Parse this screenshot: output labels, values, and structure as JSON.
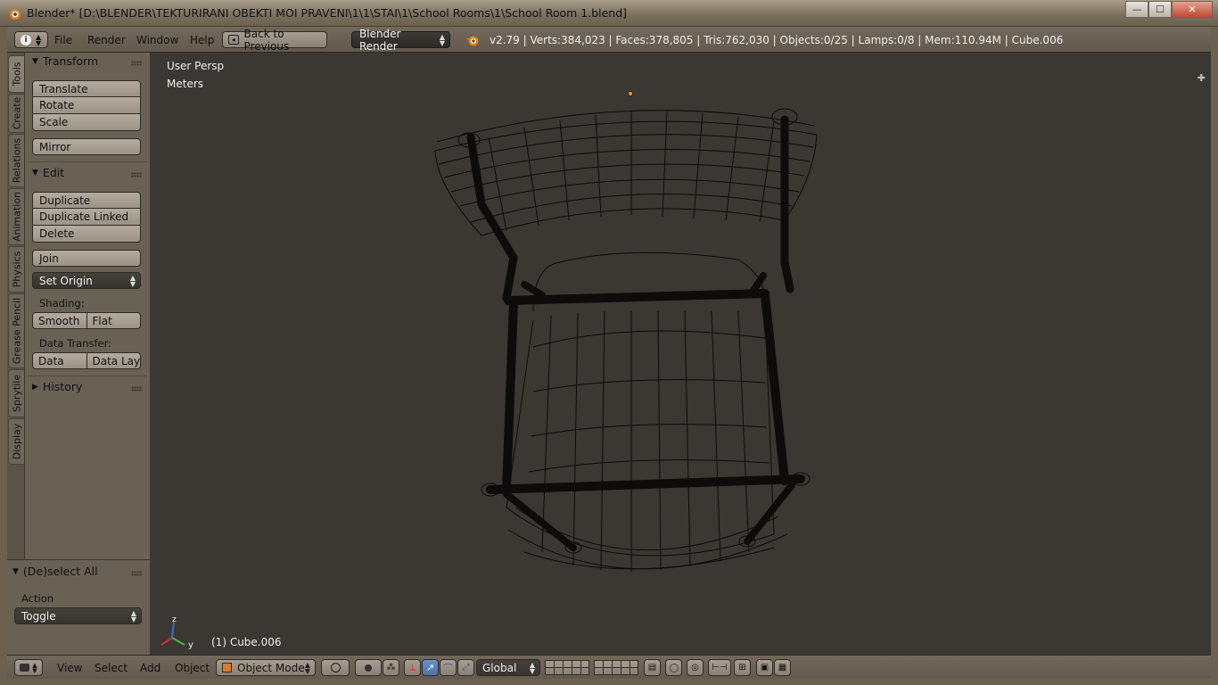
{
  "window": {
    "title": "Blender* [D:\\BLENDER\\TEKTURIRANI OBEKTI MOI PRAVENI\\1\\1\\STAI\\1\\School Rooms\\1\\School Room 1.blend]",
    "minimize_glyph": "—",
    "maximize_glyph": "☐",
    "close_glyph": "✕"
  },
  "info_header": {
    "menus": [
      "File",
      "Render",
      "Window",
      "Help"
    ],
    "back_button": "Back to Previous",
    "render_engine": "Blender Render",
    "stats": "v2.79 | Verts:384,023 | Faces:378,805 | Tris:762,030 | Objects:0/25 | Lamps:0/8 | Mem:110.94M | Cube.006"
  },
  "tool_tabs": [
    "Tools",
    "Create",
    "Relations",
    "Animation",
    "Physics",
    "Grease Pencil",
    "Sprytile",
    "Display"
  ],
  "tools_panel": {
    "transform_header": "Transform",
    "translate": "Translate",
    "rotate": "Rotate",
    "scale": "Scale",
    "mirror": "Mirror",
    "edit_header": "Edit",
    "duplicate": "Duplicate",
    "duplicate_linked": "Duplicate Linked",
    "delete": "Delete",
    "join": "Join",
    "set_origin": "Set Origin",
    "shading_label": "Shading:",
    "smooth": "Smooth",
    "flat": "Flat",
    "data_transfer_label": "Data Transfer:",
    "data": "Data",
    "data_layout": "Data Layo",
    "history_header": "History"
  },
  "operator_panel": {
    "header": "(De)select All",
    "action_label": "Action",
    "action_value": "Toggle"
  },
  "viewport": {
    "view_name": "User Persp",
    "units": "Meters",
    "object_label": "(1) Cube.006"
  },
  "bottom_header": {
    "menus": [
      "View",
      "Select",
      "Add",
      "Object"
    ],
    "mode": "Object Mode",
    "orientation": "Global"
  },
  "colors": {
    "viewport_bg": "#3b3732",
    "panel_bg": "#6a6155",
    "header_bg": "#6a6155",
    "wire": "#0d0c0b",
    "accent_blue": "#5a80bd"
  }
}
